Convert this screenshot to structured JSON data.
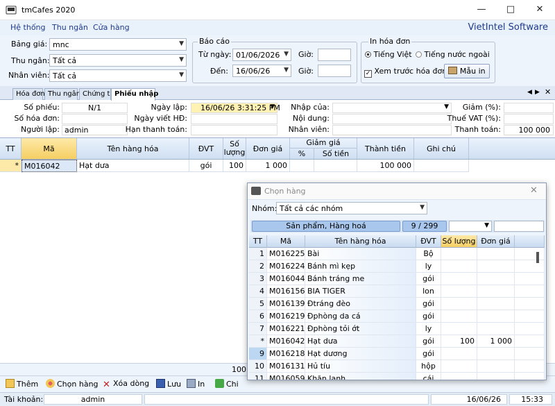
{
  "app": {
    "title": "tmCafes 2020",
    "brand": "VietIntel Software"
  },
  "menu": [
    "Hệ thống",
    "Thu ngân",
    "Cửa hàng"
  ],
  "filters": {
    "bang_gia_label": "Bảng giá:",
    "bang_gia_value": "mnc",
    "thu_ngan_label": "Thu ngân:",
    "thu_ngan_value": "Tất cả",
    "nhan_vien_label": "Nhân viên:",
    "nhan_vien_value": "Tất cả"
  },
  "bao_cao": {
    "title": "Báo cáo",
    "tu_ngay_label": "Từ ngày:",
    "tu_ngay_value": "01/06/2026",
    "den_label": "Đến:",
    "den_value": "16/06/26",
    "gio_label": "Giờ:"
  },
  "in_hoa_don": {
    "title": "In hóa đơn",
    "tieng_viet": "Tiếng Việt",
    "tieng_nuoc_ngoai": "Tiếng nước ngoài",
    "xem_truoc": "Xem trước hóa đơn",
    "mau_in": "Mẫu in"
  },
  "tabs": [
    "Hóa đơn",
    "Thu ngân",
    "Chứng từ",
    "Phiếu nhập"
  ],
  "form": {
    "so_phieu_label": "Số phiếu:",
    "so_phieu_value": "N/1",
    "so_hoa_don_label": "Số hóa đơn:",
    "nguoi_lap_label": "Người lập:",
    "nguoi_lap_value": "admin",
    "ngay_lap_label": "Ngày lập:",
    "ngay_lap_value": "16/06/26 3:31:25 PM",
    "ngay_viet_hd_label": "Ngày viết HĐ:",
    "han_thanh_toan_label": "Hạn thanh toán:",
    "nhap_cua_label": "Nhập của:",
    "noi_dung_label": "Nội dung:",
    "nhan_vien_label": "Nhân viên:",
    "giam_label": "Giảm (%):",
    "thue_vat_label": "Thuế VAT (%):",
    "thanh_toan_label": "Thanh toán:",
    "thanh_toan_value": "100 000"
  },
  "grid": {
    "headers": {
      "tt": "TT",
      "ma": "Mã",
      "ten": "Tên hàng hóa",
      "dvt": "ĐVT",
      "so_luong": "Số lượng",
      "don_gia": "Đơn giá",
      "giam_gia": "Giảm giá",
      "pct": "%",
      "so_tien": "Số tiền",
      "thanh_tien": "Thành tiền",
      "ghi_chu": "Ghi chú"
    },
    "row": {
      "marker": "*",
      "ma": "M016042",
      "ten": "Hạt dưa",
      "dvt": "gói",
      "so_luong": "100",
      "don_gia": "1 000",
      "thanh_tien": "100 000"
    },
    "total_qty": "100"
  },
  "toolbar": {
    "them": "Thêm",
    "chon_hang": "Chọn hàng",
    "xoa_dong": "Xóa dòng",
    "luu": "Lưu",
    "in": "In",
    "chi": "Chi"
  },
  "status": {
    "tai_khoan_label": "Tài khoản:",
    "tai_khoan_value": "admin",
    "date": "16/06/26",
    "time": "15:33"
  },
  "dialog": {
    "title": "Chọn hàng",
    "nhom_label": "Nhóm:",
    "nhom_value": "Tất cả các nhóm",
    "category": "Sản phẩm, Hàng hoá",
    "count": "9 / 299",
    "headers": {
      "tt": "TT",
      "ma": "Mã",
      "ten": "Tên hàng hóa",
      "dvt": "ĐVT",
      "so_luong": "Số lượng",
      "don_gia": "Đơn giá"
    },
    "rows": [
      {
        "tt": "1",
        "ma": "M016225",
        "ten": "Bài",
        "dvt": "Bộ",
        "so_luong": "",
        "don_gia": ""
      },
      {
        "tt": "2",
        "ma": "M016224",
        "ten": "Bánh mì kẹp",
        "dvt": "ly",
        "so_luong": "",
        "don_gia": ""
      },
      {
        "tt": "3",
        "ma": "M016044",
        "ten": "Bánh tráng me",
        "dvt": "gói",
        "so_luong": "",
        "don_gia": ""
      },
      {
        "tt": "4",
        "ma": "M016156",
        "ten": "BIA TIGER",
        "dvt": "lon",
        "so_luong": "",
        "don_gia": ""
      },
      {
        "tt": "5",
        "ma": "M016139",
        "ten": "Đtráng đèo",
        "dvt": "gói",
        "so_luong": "",
        "don_gia": ""
      },
      {
        "tt": "6",
        "ma": "M016219",
        "ten": "Đphòng da cá",
        "dvt": "gói",
        "so_luong": "",
        "don_gia": ""
      },
      {
        "tt": "7",
        "ma": "M016221",
        "ten": "Đphòng tỏi ớt",
        "dvt": "ly",
        "so_luong": "",
        "don_gia": ""
      },
      {
        "tt": "*",
        "ma": "M016042",
        "ten": "Hạt dưa",
        "dvt": "gói",
        "so_luong": "100",
        "don_gia": "1 000"
      },
      {
        "tt": "9",
        "ma": "M016218",
        "ten": "Hạt dương",
        "dvt": "gói",
        "so_luong": "",
        "don_gia": ""
      },
      {
        "tt": "10",
        "ma": "M016131",
        "ten": "Hủ tíu",
        "dvt": "hộp",
        "so_luong": "",
        "don_gia": ""
      },
      {
        "tt": "11",
        "ma": "M016059",
        "ten": "Khăn lạnh",
        "dvt": "cái",
        "so_luong": "",
        "don_gia": ""
      }
    ]
  }
}
